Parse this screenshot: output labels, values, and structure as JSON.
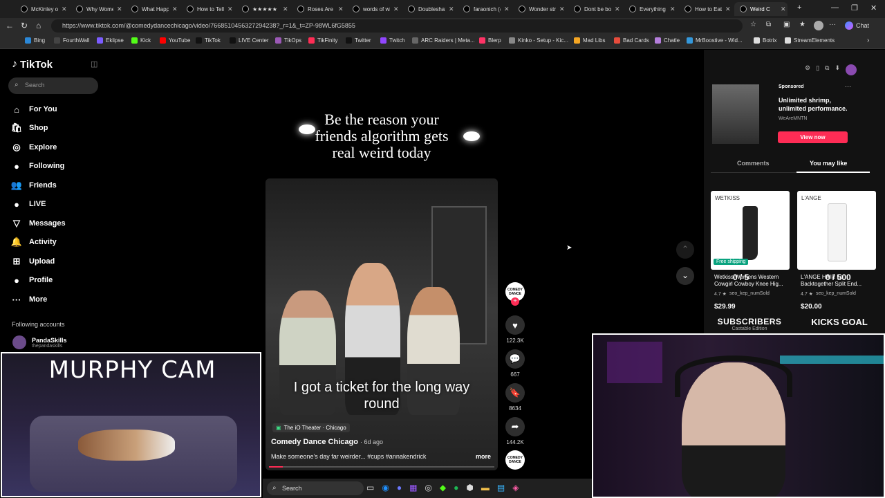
{
  "browser": {
    "tabs": [
      {
        "title": "McKinley on"
      },
      {
        "title": "Why Women"
      },
      {
        "title": "What Happe"
      },
      {
        "title": "How to Tell Y"
      },
      {
        "title": "★★★★★"
      },
      {
        "title": "Roses Are Re"
      },
      {
        "title": "words of wis"
      },
      {
        "title": "Doubleshaft"
      },
      {
        "title": "faraonich (@"
      },
      {
        "title": "Wonder strik"
      },
      {
        "title": "Dont be bori"
      },
      {
        "title": "Everything w"
      },
      {
        "title": "How to Eat N"
      },
      {
        "title": "Weird C"
      }
    ],
    "new_tab": "+",
    "window_controls": {
      "minimize": "—",
      "maximize": "❐",
      "close": "✕"
    },
    "url": "https://www.tiktok.com/@comedydancechicago/video/7668510456327294238?_r=1&_t=ZP-98WL6fG5855",
    "chat_label": "Chat",
    "bookmarks": [
      {
        "label": "Bing",
        "color": "#2b88d8"
      },
      {
        "label": "FourthWall",
        "color": "#444"
      },
      {
        "label": "Eklipse",
        "color": "#7b5cff"
      },
      {
        "label": "Kick",
        "color": "#53fc18"
      },
      {
        "label": "YouTube",
        "color": "#ff0000"
      },
      {
        "label": "TikTok",
        "color": "#111"
      },
      {
        "label": "LIVE Center",
        "color": "#111"
      },
      {
        "label": "TikOps",
        "color": "#9b59b6"
      },
      {
        "label": "TikFinity",
        "color": "#ff2d55"
      },
      {
        "label": "Twitter",
        "color": "#111"
      },
      {
        "label": "Twitch",
        "color": "#9146ff"
      },
      {
        "label": "ARC Raiders | Meta...",
        "color": "#666"
      },
      {
        "label": "Blerp",
        "color": "#ff3366"
      },
      {
        "label": "Kinko - Setup - Kic...",
        "color": "#888"
      },
      {
        "label": "Mad Libs",
        "color": "#f5a623"
      },
      {
        "label": "Bad Cards",
        "color": "#e74c3c"
      },
      {
        "label": "Chatle",
        "color": "#b57edc"
      },
      {
        "label": "MrBoostive - Wid...",
        "color": "#3498db"
      },
      {
        "label": "Botrix",
        "color": "#ddd"
      },
      {
        "label": "StreamElements",
        "color": "#ddd"
      }
    ]
  },
  "tiktok": {
    "logo": "TikTok",
    "search_placeholder": "Search",
    "nav": [
      {
        "label": "For You",
        "icon": "home-icon",
        "glyph": "⌂"
      },
      {
        "label": "Shop",
        "icon": "shopping-bag-icon",
        "glyph": "🛍"
      },
      {
        "label": "Explore",
        "icon": "compass-icon",
        "glyph": "◎"
      },
      {
        "label": "Following",
        "icon": "avatar-icon",
        "glyph": "●"
      },
      {
        "label": "Friends",
        "icon": "friends-icon",
        "glyph": "👥"
      },
      {
        "label": "LIVE",
        "icon": "live-avatar-icon",
        "glyph": "●"
      },
      {
        "label": "Messages",
        "icon": "inbox-icon",
        "glyph": "▽"
      },
      {
        "label": "Activity",
        "icon": "bell-icon",
        "glyph": "🔔"
      },
      {
        "label": "Upload",
        "icon": "upload-icon",
        "glyph": "⊞"
      },
      {
        "label": "Profile",
        "icon": "profile-icon",
        "glyph": "●"
      },
      {
        "label": "More",
        "icon": "more-icon",
        "glyph": "···"
      }
    ],
    "following_header": "Following accounts",
    "following_accounts": [
      {
        "name": "PandaSkills",
        "handle": "thepandaskills"
      }
    ],
    "video": {
      "caption_top": "Be the reason your friends algorithm gets real weird today",
      "subtitle": "I got a ticket for the long way round",
      "location": "The iO Theater · Chicago",
      "author": "Comedy Dance Chicago",
      "age": "6d ago",
      "description": "Make someone's day far weirder... #cups #annakendrick",
      "more": "more"
    },
    "actions": [
      {
        "name": "like",
        "count": "122.3K",
        "glyph": "♥"
      },
      {
        "name": "comment",
        "count": "667",
        "glyph": "💬"
      },
      {
        "name": "bookmark",
        "count": "8634",
        "glyph": "🔖"
      },
      {
        "name": "share",
        "count": "144.2K",
        "glyph": "➦"
      }
    ],
    "avatar_label": "COMEDY DANCE",
    "sponsored": {
      "tag": "Sponsored",
      "headline": "Unlimited shrimp, unlimited performance.",
      "advertiser": "WeAreMNTN",
      "cta": "View now"
    },
    "tabs": [
      "Comments",
      "You may like"
    ],
    "products": [
      {
        "brand": "WETKISS",
        "badge": "Free shipping",
        "title": "Wetkiss Womens Western Cowgirl Cowboy Knee Hig...",
        "rating": "4.7 ★",
        "seller": "seo_kep_numSold",
        "price": "$29.99"
      },
      {
        "brand": "L'ANGE",
        "badge": "",
        "title": "L'ANGE HAIR Le Backtogether Split End...",
        "rating": "4.7 ★",
        "seller": "seo_kep_numSold",
        "price": "$20.00"
      }
    ]
  },
  "stream_overlays": {
    "cam_label": "MURPHY CAM",
    "subscribers_label": "SUBSCRIBERS",
    "subscribers_sub": "Castable Edition",
    "kicks_goal_label": "KICKS GOAL",
    "kicks_goal_value": "0 / 500",
    "subs_value": "0 / 5"
  },
  "taskbar": {
    "search": "Search"
  }
}
